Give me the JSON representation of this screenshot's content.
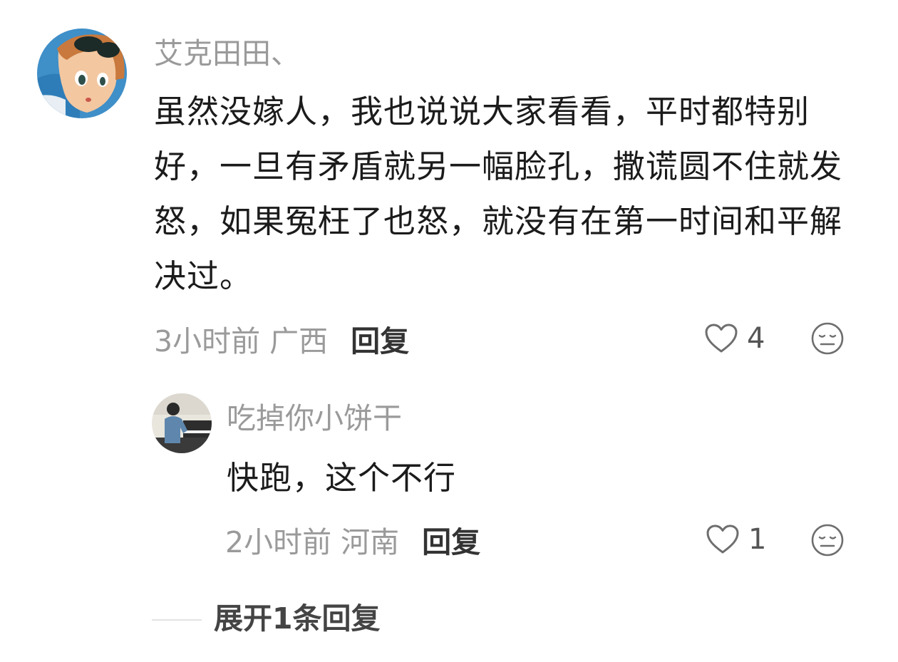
{
  "comment": {
    "username": "艾克田田、",
    "text": "虽然没嫁人，我也说说大家看看，平时都特别好，一旦有矛盾就另一幅脸孔，撒谎圆不住就发怒，如果冤枉了也怒，就没有在第一时间和平解决过。",
    "time_location": "3小时前 广西",
    "reply_label": "回复",
    "like_count": "4",
    "avatar_icon": "anime-avatar-icon",
    "like_icon": "heart-outline-icon",
    "dislike_icon": "neutral-face-icon"
  },
  "reply": {
    "username": "吃掉你小饼干",
    "text": "快跑，这个不行",
    "time_location": "2小时前 河南",
    "reply_label": "回复",
    "like_count": "1",
    "avatar_icon": "piano-player-avatar-icon",
    "like_icon": "heart-outline-icon",
    "dislike_icon": "neutral-face-icon"
  },
  "expand": {
    "label": "展开1条回复"
  },
  "colors": {
    "username": "#9a9a9a",
    "text": "#1b1b1b",
    "meta": "#9a9a9a",
    "reply_label": "#333333",
    "icon_stroke": "#6e6e6e"
  }
}
